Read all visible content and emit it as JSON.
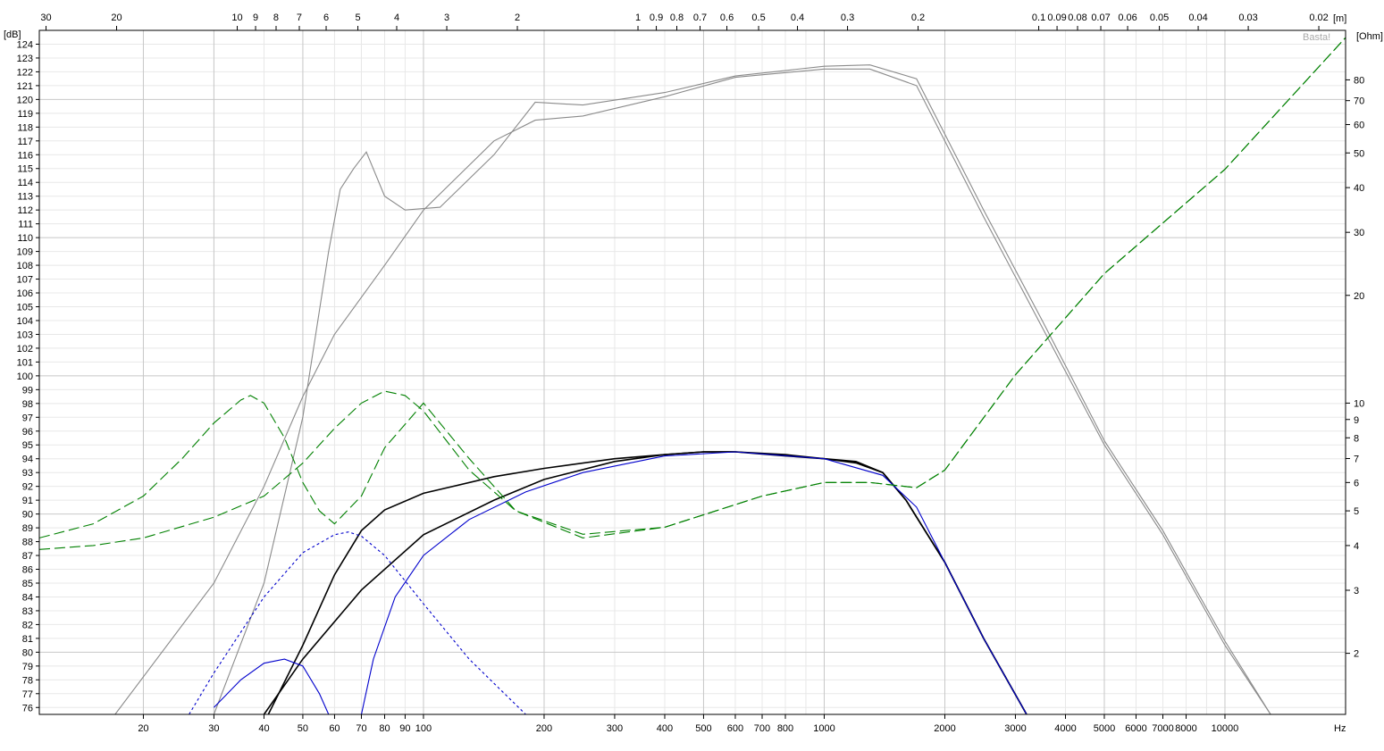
{
  "chart_data": {
    "type": "line",
    "title": "",
    "watermark": "Basta!",
    "xlabel": "Hz",
    "ylabel": "[dB]",
    "y2label": "[Ohm]",
    "x2label": "[m]",
    "x_scale": "log",
    "xlim": [
      11,
      20000
    ],
    "ylim": [
      75.5,
      125
    ],
    "y2_scale": "log",
    "y2lim": [
      1.35,
      110
    ],
    "grid": true,
    "x_major_ticks": [
      20,
      30,
      40,
      50,
      60,
      70,
      80,
      90,
      100,
      200,
      300,
      400,
      500,
      600,
      700,
      800,
      1000,
      2000,
      3000,
      4000,
      5000,
      6000,
      7000,
      8000,
      10000
    ],
    "x_tick_labels": [
      "20",
      "30",
      "40",
      "50",
      "60",
      "70",
      "80",
      "90",
      "100",
      "200",
      "300",
      "400",
      "500",
      "600",
      "700",
      "800",
      "1000",
      "2000",
      "3000",
      "4000",
      "5000",
      "6000",
      "7000",
      "8000",
      "10000"
    ],
    "y_ticks": [
      76,
      77,
      78,
      79,
      80,
      81,
      82,
      83,
      84,
      85,
      86,
      87,
      88,
      89,
      90,
      91,
      92,
      93,
      94,
      95,
      96,
      97,
      98,
      99,
      100,
      101,
      102,
      103,
      104,
      105,
      106,
      107,
      108,
      109,
      110,
      111,
      112,
      113,
      114,
      115,
      116,
      117,
      118,
      119,
      120,
      121,
      122,
      123,
      124
    ],
    "y2_ticks": [
      2,
      3,
      4,
      5,
      6,
      7,
      8,
      9,
      10,
      20,
      30,
      40,
      50,
      60,
      70,
      80
    ],
    "wavelength_ticks": [
      30,
      20,
      10,
      9,
      8,
      7,
      6,
      5,
      4,
      3,
      2,
      1,
      0.9,
      0.8,
      0.7,
      0.6,
      0.5,
      0.4,
      0.3,
      0.2,
      0.1,
      0.09,
      0.08,
      0.07,
      0.06,
      0.05,
      0.04,
      0.03,
      0.02
    ],
    "wavelength_tick_labels": [
      "30",
      "20",
      "10",
      "9",
      "8",
      "7",
      "6",
      "5",
      "4",
      "3",
      "2",
      "1",
      "0.9",
      "0.8",
      "0.7",
      "0.6",
      "0.5",
      "0.4",
      "0.3",
      "0.2",
      "0.1",
      "0.09",
      "0.08",
      "0.07",
      "0.06",
      "0.05",
      "0.04",
      "0.03",
      "0.02"
    ],
    "colors": {
      "grey": "#8a8a8a",
      "black": "#000000",
      "blue": "#0000cc",
      "green": "#008000",
      "grid_major": "#c8c8c8",
      "grid_minor": "#e8e8e8"
    },
    "series": [
      {
        "axis": "y",
        "color": "#8a8a8a",
        "style": "solid",
        "x": [
          17,
          30,
          40,
          50,
          60,
          80,
          100,
          150,
          190,
          250,
          400,
          600,
          1000,
          1300,
          1700,
          2500,
          3500,
          5000,
          7000,
          10000,
          13000
        ],
        "y": [
          75.5,
          85,
          92,
          98.5,
          103,
          108,
          112,
          117,
          118.5,
          118.8,
          120.2,
          121.6,
          122.2,
          122.2,
          121,
          111.5,
          103.5,
          95,
          88.5,
          80.5,
          75.5
        ]
      },
      {
        "axis": "y",
        "color": "#8a8a8a",
        "style": "solid",
        "x": [
          30,
          40,
          50,
          58,
          62,
          67,
          72,
          80,
          90,
          110,
          150,
          190,
          250,
          400,
          600,
          1000,
          1300,
          1700,
          2500,
          3500,
          5000,
          7000,
          10000,
          13000
        ],
        "y": [
          75.5,
          85,
          97,
          109,
          113.5,
          115,
          116.2,
          113,
          112,
          112.2,
          116,
          119.8,
          119.6,
          120.5,
          121.7,
          122.4,
          122.5,
          121.5,
          112,
          104,
          95.3,
          88.8,
          80.8,
          75.5
        ]
      },
      {
        "axis": "y",
        "color": "#000000",
        "style": "solid",
        "x": [
          41,
          50,
          60,
          70,
          80,
          100,
          150,
          200,
          300,
          400,
          500,
          600,
          800,
          1000,
          1200,
          1400,
          1600,
          2000,
          2500,
          3200
        ],
        "y": [
          75.5,
          80.5,
          85.6,
          88.8,
          90.3,
          91.5,
          92.7,
          93.3,
          94,
          94.3,
          94.5,
          94.5,
          94.3,
          94,
          93.8,
          93,
          91,
          86.5,
          81,
          75.5
        ]
      },
      {
        "axis": "y",
        "color": "#000000",
        "style": "solid",
        "x": [
          40,
          50,
          70,
          100,
          150,
          200,
          300,
          400,
          500,
          600,
          800,
          1000,
          1200,
          1400,
          1600,
          2000,
          2500,
          3200
        ],
        "y": [
          75.5,
          79.5,
          84.5,
          88.5,
          91,
          92.5,
          93.8,
          94.3,
          94.5,
          94.5,
          94.2,
          94,
          93.7,
          93,
          91,
          86.5,
          81,
          75.5
        ]
      },
      {
        "axis": "y",
        "color": "#0000cc",
        "style": "solid",
        "x": [
          70,
          75,
          85,
          100,
          130,
          180,
          250,
          400,
          600,
          1000,
          1400,
          1700,
          2000,
          2500,
          3200
        ],
        "y": [
          75.5,
          79.5,
          84,
          87,
          89.6,
          91.6,
          93,
          94.2,
          94.5,
          94,
          92.8,
          90.5,
          86.5,
          81,
          75.5
        ]
      },
      {
        "axis": "y",
        "color": "#0000cc",
        "style": "solid",
        "x": [
          30,
          35,
          40,
          45,
          50,
          55,
          58
        ],
        "y": [
          76,
          78,
          79.2,
          79.5,
          79,
          77,
          75.5
        ]
      },
      {
        "axis": "y",
        "color": "#0000cc",
        "style": "dotted",
        "x": [
          26,
          30,
          40,
          50,
          60,
          65,
          70,
          80,
          100,
          130,
          180
        ],
        "y": [
          75.5,
          78.5,
          84,
          87.2,
          88.5,
          88.7,
          88.4,
          87,
          83.5,
          79.5,
          75.5
        ]
      },
      {
        "axis": "y2",
        "color": "#008000",
        "style": "dashed",
        "x": [
          11,
          15,
          20,
          25,
          30,
          35,
          37,
          40,
          45,
          50,
          55,
          60,
          70,
          80,
          100,
          130,
          170,
          250,
          400,
          700,
          1000,
          1300,
          1700,
          2000,
          3000,
          5000,
          10000,
          20000
        ],
        "y": [
          4.2,
          4.6,
          5.5,
          7,
          8.8,
          10.2,
          10.5,
          10,
          8,
          6,
          5,
          4.6,
          5.5,
          7.5,
          10,
          7,
          5,
          4.2,
          4.5,
          5.5,
          6,
          6,
          5.8,
          6.5,
          12,
          23,
          45,
          105
        ]
      },
      {
        "axis": "y2",
        "color": "#008000",
        "style": "dashed",
        "x": [
          11,
          15,
          20,
          30,
          40,
          50,
          60,
          70,
          80,
          90,
          100,
          130,
          170,
          250,
          400,
          700,
          1000,
          1300,
          1700,
          2000,
          3000,
          5000,
          10000,
          20000
        ],
        "y": [
          3.9,
          4,
          4.2,
          4.8,
          5.5,
          6.8,
          8.5,
          10,
          10.8,
          10.5,
          9.5,
          6.5,
          5,
          4.3,
          4.5,
          5.5,
          6,
          6,
          5.8,
          6.5,
          12,
          23,
          45,
          105
        ]
      }
    ]
  }
}
